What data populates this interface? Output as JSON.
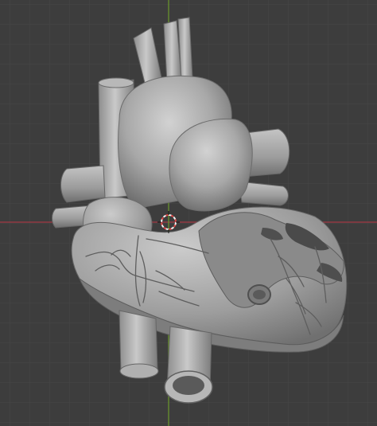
{
  "viewport": {
    "background": "#3d3d3d",
    "grid_minor_color": "#474747",
    "grid_major_color": "#525252",
    "x_axis_color": "#a33a44",
    "y_axis_color": "#6c9a2c"
  },
  "object": {
    "icon": "heart-mesh-icon",
    "base_color": "#a9a9a9",
    "shadow_color": "#6f6f6f",
    "highlight_color": "#cfcfcf",
    "vessel_color": "#5e5e5e"
  },
  "cursor": {
    "icon": "3d-cursor-icon",
    "ring_red": "#e04545",
    "ring_white": "#f2f2f2"
  }
}
